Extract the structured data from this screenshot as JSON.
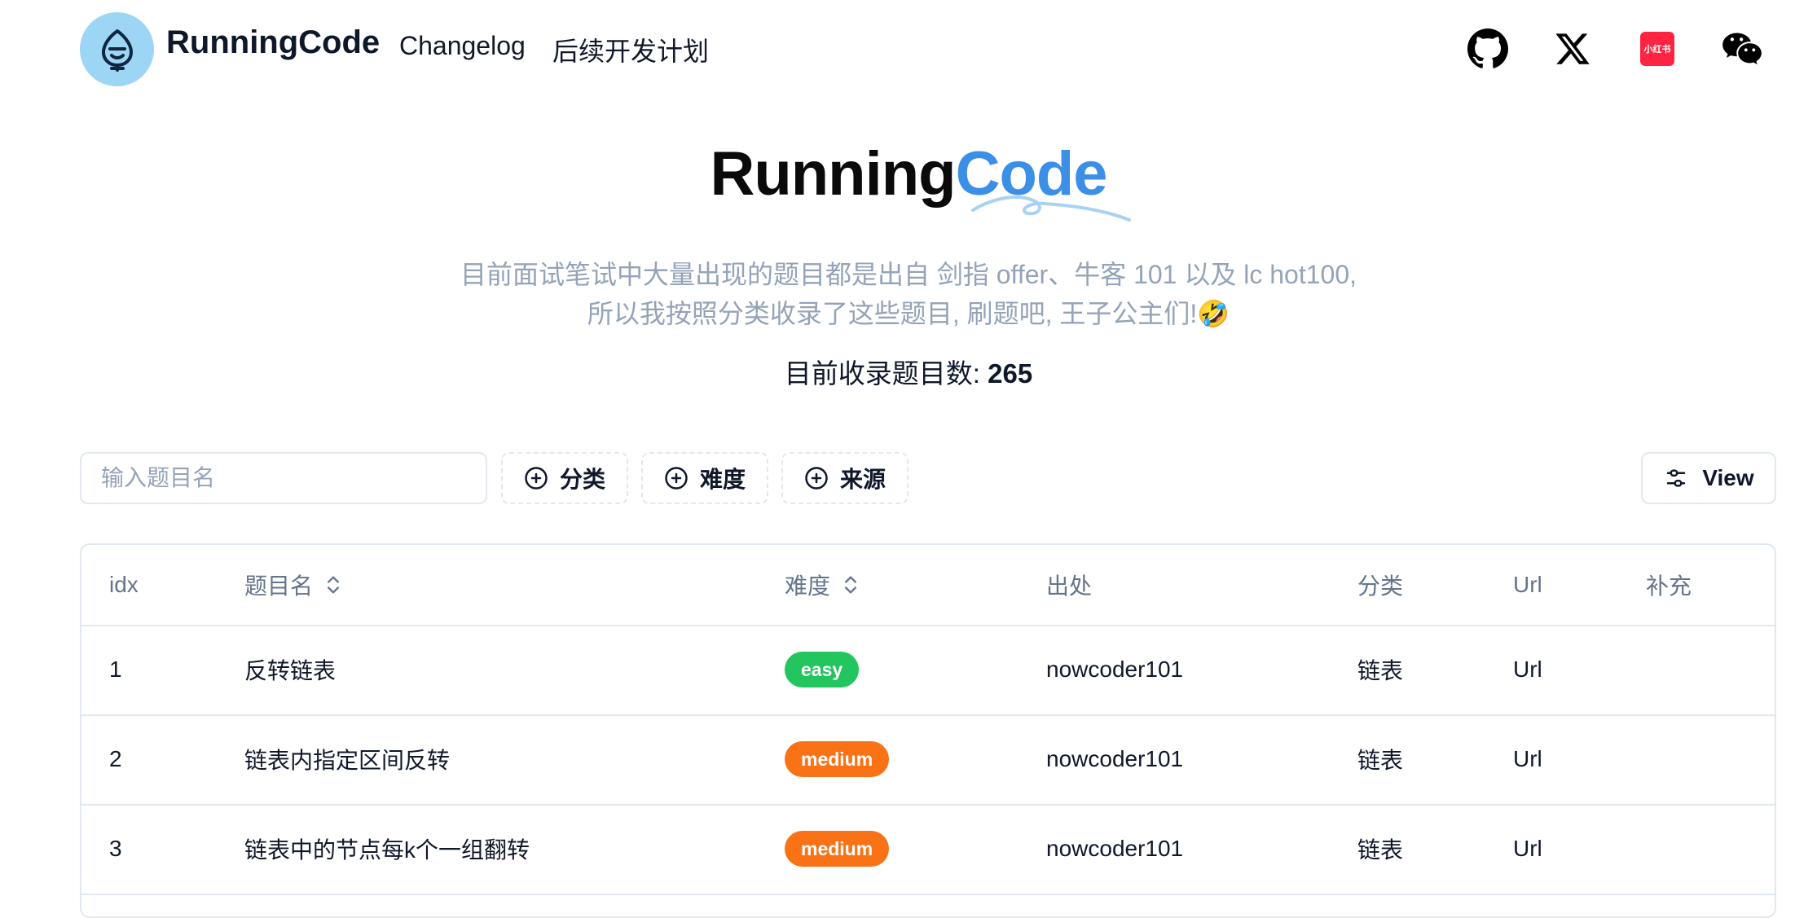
{
  "header": {
    "brand": "RunningCode",
    "nav": {
      "changelog": "Changelog",
      "plan": "后续开发计划"
    },
    "xiaohongshu_badge": "小红书",
    "icons": [
      "github-icon",
      "x-icon",
      "xiaohongshu-icon",
      "wechat-icon"
    ]
  },
  "hero": {
    "title_part1": "Running",
    "title_part2": "Code",
    "subtitle_line1": "目前面试笔试中大量出现的题目都是出自 剑指 offer、牛客 101 以及 lc hot100,",
    "subtitle_line2": "所以我按照分类收录了这些题目, 刷题吧, 王子公主们!🤣",
    "count_label": "目前收录题目数: ",
    "count_value": "265"
  },
  "toolbar": {
    "search_placeholder": "输入题目名",
    "filter_category": "分类",
    "filter_difficulty": "难度",
    "filter_source": "来源",
    "view_label": "View"
  },
  "table": {
    "headers": {
      "idx": "idx",
      "name": "题目名",
      "difficulty": "难度",
      "source": "出处",
      "category": "分类",
      "url": "Url",
      "note": "补充"
    },
    "rows": [
      {
        "idx": "1",
        "name": "反转链表",
        "difficulty": "easy",
        "source": "nowcoder101",
        "category": "链表",
        "url": "Url",
        "note": ""
      },
      {
        "idx": "2",
        "name": "链表内指定区间反转",
        "difficulty": "medium",
        "source": "nowcoder101",
        "category": "链表",
        "url": "Url",
        "note": ""
      },
      {
        "idx": "3",
        "name": "链表中的节点每k个一组翻转",
        "difficulty": "medium",
        "source": "nowcoder101",
        "category": "链表",
        "url": "Url",
        "note": ""
      }
    ]
  },
  "colors": {
    "accent": "#3b8fe6",
    "logo_bg": "#9dd6f5",
    "easy": "#22c55e",
    "medium": "#f97316",
    "muted": "#94a3b8",
    "border": "#e2e8f0"
  }
}
